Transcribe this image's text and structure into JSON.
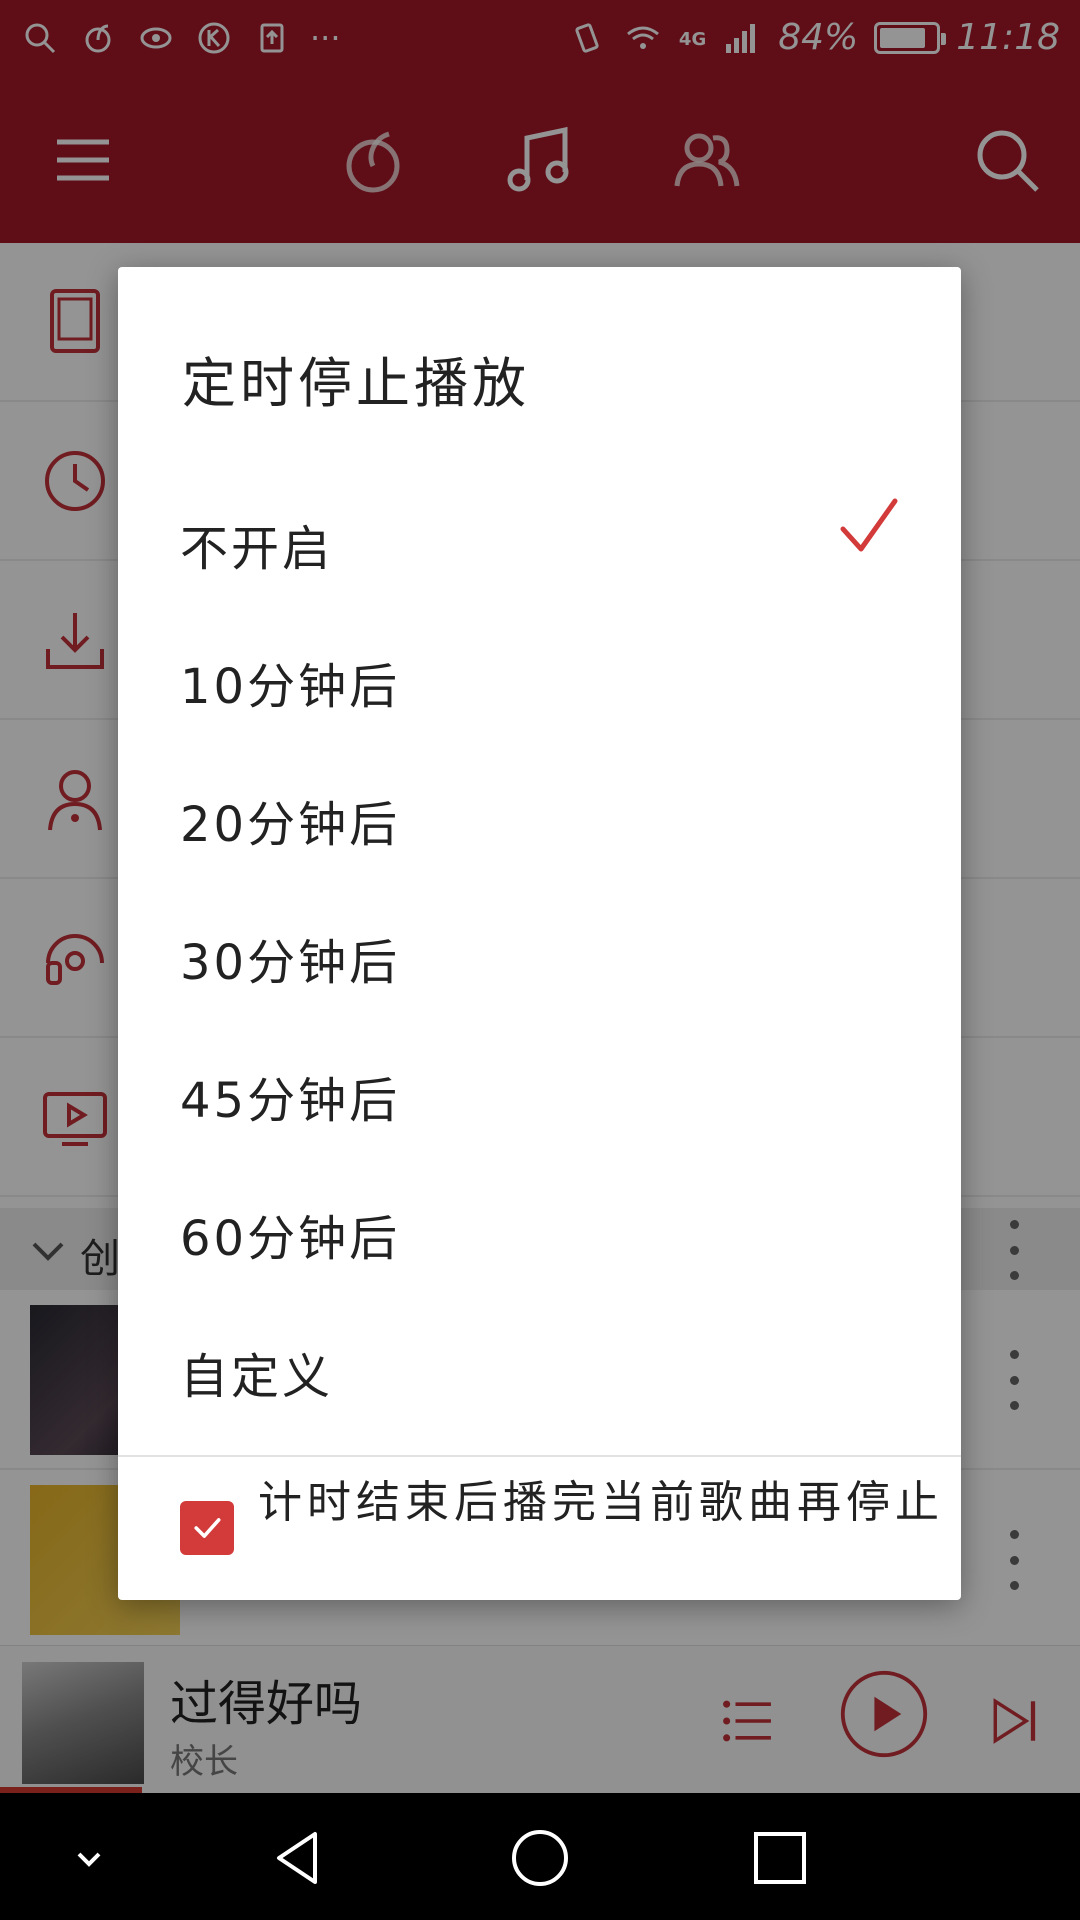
{
  "status_bar": {
    "network": "4G",
    "battery_text": "84%",
    "battery_level": 0.84,
    "time": "11:18",
    "more": "···"
  },
  "header_icons": [
    "menu-icon",
    "netease-logo-icon",
    "music-note-icon",
    "friends-icon",
    "search-icon"
  ],
  "background": {
    "menu_icons": [
      "local-music-icon",
      "recent-play-icon",
      "download-icon",
      "my-radio-icon",
      "collection-icon",
      "mv-icon"
    ],
    "section_title": "创"
  },
  "mini_player": {
    "title": "过得好吗",
    "artist": "校长"
  },
  "dialog": {
    "title": "定时停止播放",
    "options": [
      {
        "label": "不开启",
        "selected": true
      },
      {
        "label": "10分钟后",
        "selected": false
      },
      {
        "label": "20分钟后",
        "selected": false
      },
      {
        "label": "30分钟后",
        "selected": false
      },
      {
        "label": "45分钟后",
        "selected": false
      },
      {
        "label": "60分钟后",
        "selected": false
      },
      {
        "label": "自定义",
        "selected": false
      }
    ],
    "footer_checkbox_label": "计时结束后播完当前歌曲再停止",
    "footer_checked": true
  },
  "colors": {
    "brand_red": "#a4192a",
    "accent_red": "#d33a3a"
  }
}
